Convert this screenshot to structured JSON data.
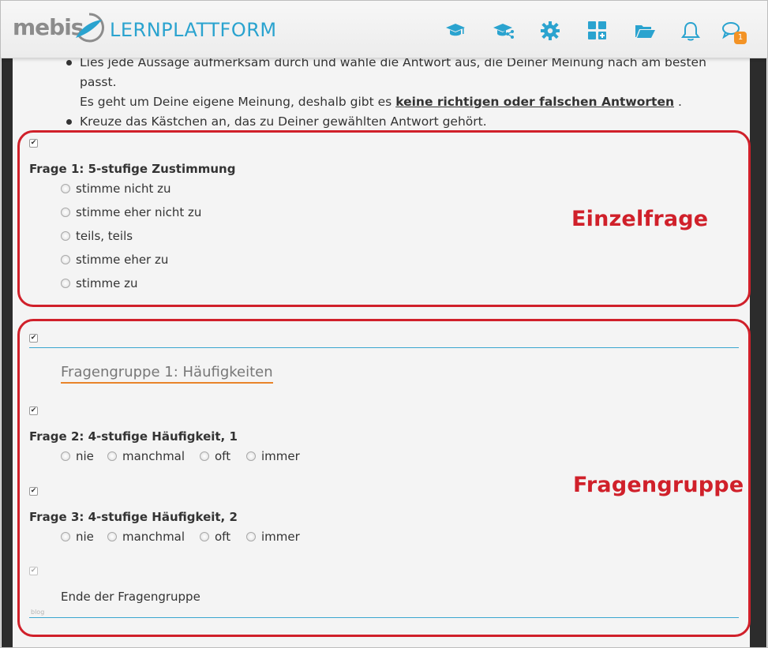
{
  "header": {
    "brand": "mebis",
    "title": "LERNPLATTFORM",
    "nav_icons": [
      "graduation-cap-icon",
      "graduation-share-icon",
      "gear-icon",
      "dashboard-add-icon",
      "folder-open-icon",
      "bell-icon",
      "chat-icon"
    ],
    "message_badge": "1"
  },
  "intro": {
    "item1_line1": "Lies jede Aussage aufmerksam durch und wähle die Antwort aus, die Deiner Meinung nach am besten passt.",
    "item1_line2_prefix": "Es geht um Deine eigene Meinung, deshalb gibt es",
    "item1_strong": "keine richtigen oder falschen Antworten",
    "item1_suffix": ".",
    "item2": "Kreuze das Kästchen an, das zu Deiner gewählten Antwort gehört."
  },
  "callouts": {
    "single": "Einzelfrage",
    "group": "Fragengruppe"
  },
  "q1": {
    "title": "Frage 1: 5-stufige Zustimmung",
    "options": [
      "stimme nicht zu",
      "stimme eher nicht zu",
      "teils, teils",
      "stimme eher zu",
      "stimme zu"
    ]
  },
  "group": {
    "title": "Fragengruppe 1: Häufigkeiten",
    "end": "Ende der Fragengruppe",
    "footer_tiny": "blog"
  },
  "q2": {
    "title": "Frage 2: 4-stufige Häufigkeit, 1",
    "options": [
      "nie",
      "manchmal",
      "oft",
      "immer"
    ]
  },
  "q3": {
    "title": "Frage 3: 4-stufige Häufigkeit, 2",
    "options": [
      "nie",
      "manchmal",
      "oft",
      "immer"
    ]
  },
  "colors": {
    "accent_blue": "#2aa3cf",
    "callout_red": "#d0202a",
    "badge_orange": "#f39325",
    "heading_underline": "#e8832a"
  }
}
